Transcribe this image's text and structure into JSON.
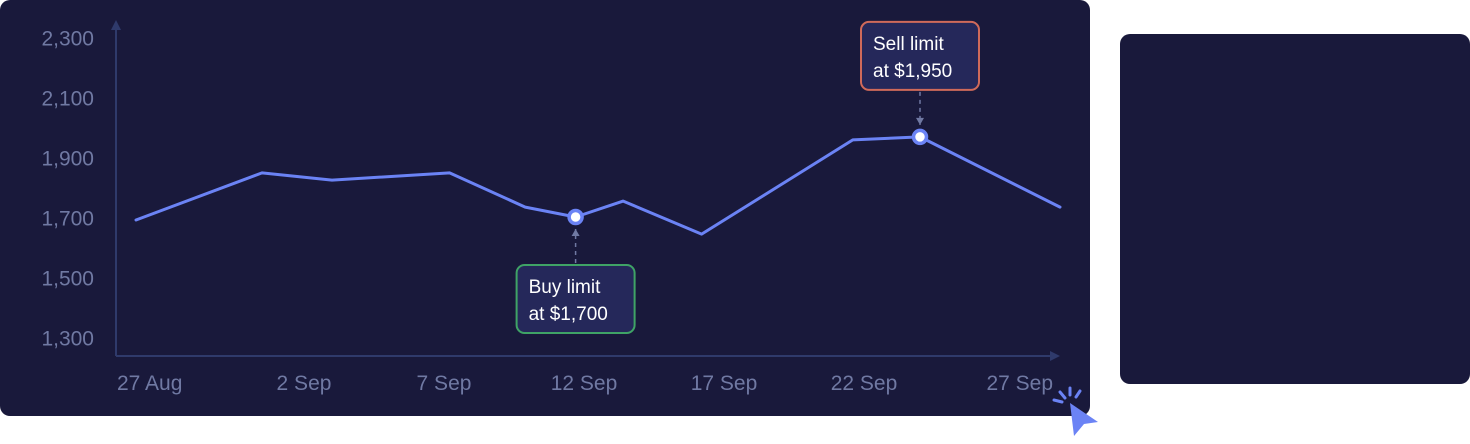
{
  "chart_data": {
    "type": "line",
    "title": "",
    "xlabel": "",
    "ylabel": "",
    "ylim": [
      1300,
      2300
    ],
    "y_ticks": [
      "2,300",
      "2,100",
      "1,900",
      "1,700",
      "1,500",
      "1,300"
    ],
    "y_tick_values": [
      2300,
      2100,
      1900,
      1700,
      1500,
      1300
    ],
    "x_ticks": [
      "27 Aug",
      "2 Sep",
      "7 Sep",
      "12 Sep",
      "17 Sep",
      "22 Sep",
      "27 Sep"
    ],
    "x_tick_days": [
      0,
      6,
      11,
      16,
      21,
      26,
      31
    ],
    "series": [
      {
        "color": "#6b83f5",
        "points": [
          {
            "day": 0,
            "value": 1700
          },
          {
            "day": 4.5,
            "value": 1857
          },
          {
            "day": 7,
            "value": 1833
          },
          {
            "day": 11.2,
            "value": 1857
          },
          {
            "day": 13.9,
            "value": 1743
          },
          {
            "day": 15.7,
            "value": 1710
          },
          {
            "day": 17.4,
            "value": 1763
          },
          {
            "day": 20.2,
            "value": 1653
          },
          {
            "day": 25.6,
            "value": 1967
          },
          {
            "day": 28,
            "value": 1977
          },
          {
            "day": 33,
            "value": 1743
          }
        ]
      }
    ],
    "annotations": [
      {
        "lines": [
          "Buy limit",
          "at $1,700"
        ],
        "day": 15.7,
        "value": 1710,
        "position": "below",
        "border_color": "#3fa366"
      },
      {
        "lines": [
          "Sell limit",
          "at $1,950"
        ],
        "day": 28,
        "value": 1977,
        "position": "above",
        "border_color": "#d06a5a"
      }
    ],
    "grid": false,
    "axis_color": "#2f3a6b",
    "tick_color": "#7079a3"
  },
  "side_panel": {
    "color": "#19193b"
  },
  "cursor": {
    "icon": "pointer-click-icon",
    "color": "#6b83f5"
  }
}
